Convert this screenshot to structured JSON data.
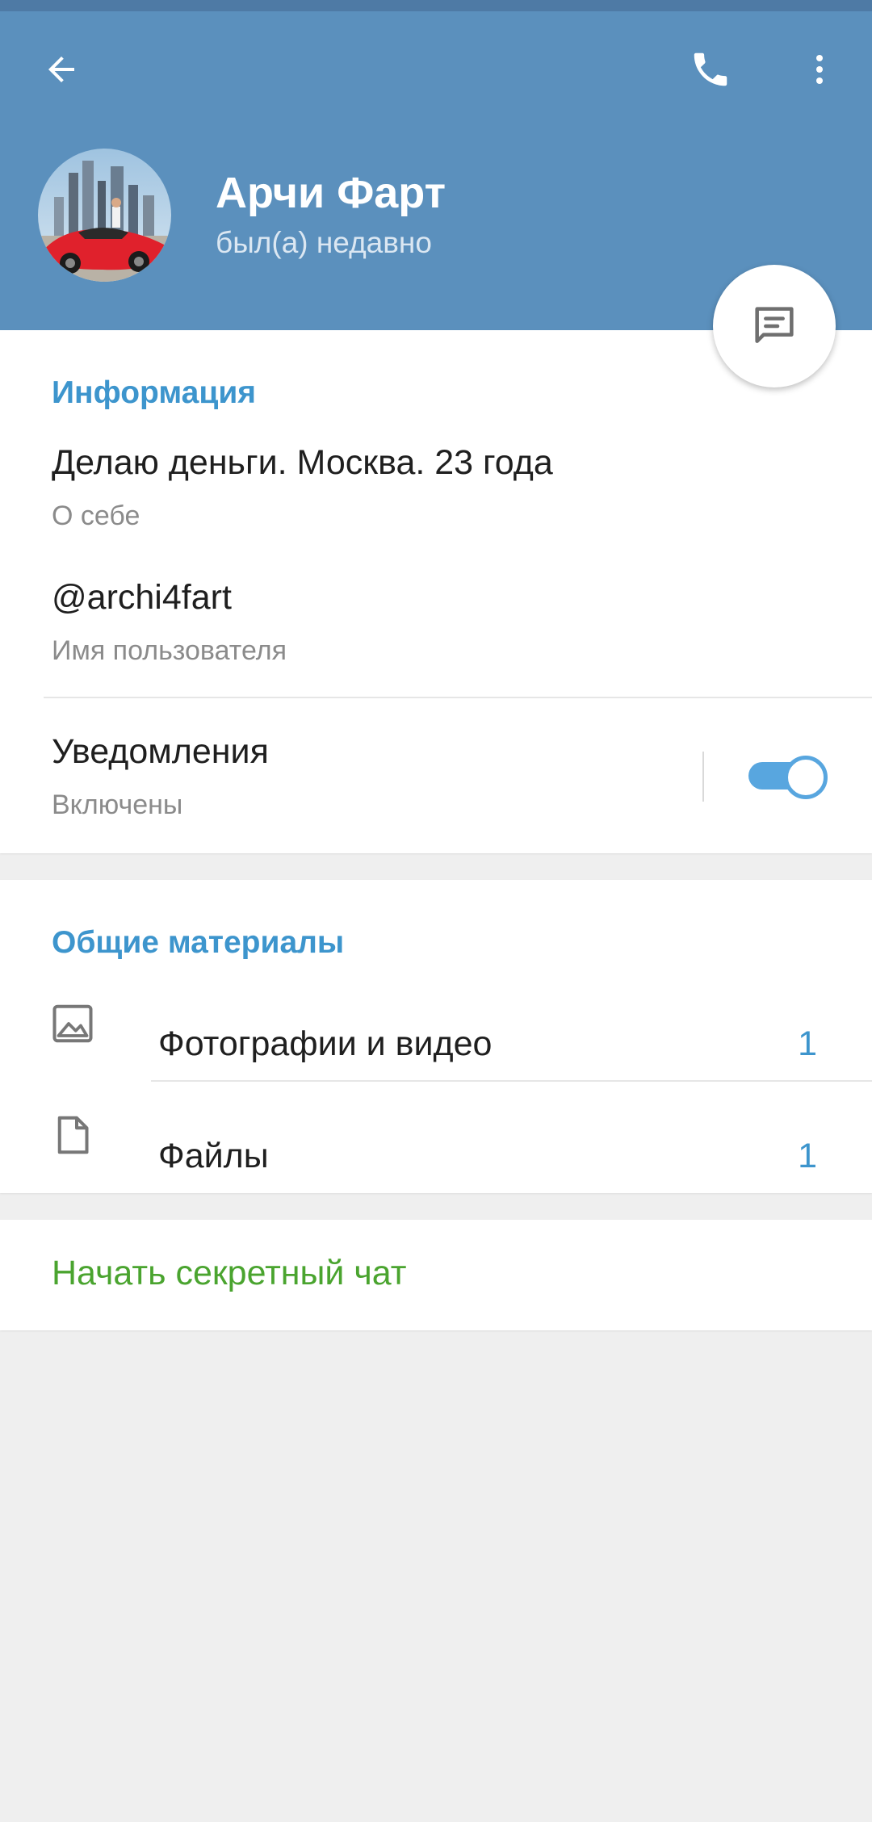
{
  "header": {
    "name": "Арчи Фарт",
    "status": "был(а) недавно",
    "accent_color": "#5b90bd"
  },
  "info": {
    "section_title": "Информация",
    "bio": "Делаю деньги. Москва. 23 года",
    "bio_caption": "О себе",
    "username": "@archi4fart",
    "username_caption": "Имя пользователя",
    "notifications_label": "Уведомления",
    "notifications_value": "Включены",
    "notifications_enabled": true
  },
  "shared": {
    "section_title": "Общие материалы",
    "items": [
      {
        "label": "Фотографии и видео",
        "count": "1",
        "icon": "image-icon"
      },
      {
        "label": "Файлы",
        "count": "1",
        "icon": "file-icon"
      }
    ]
  },
  "secret_chat": {
    "label": "Начать секретный чат",
    "color": "#4aa42f"
  }
}
